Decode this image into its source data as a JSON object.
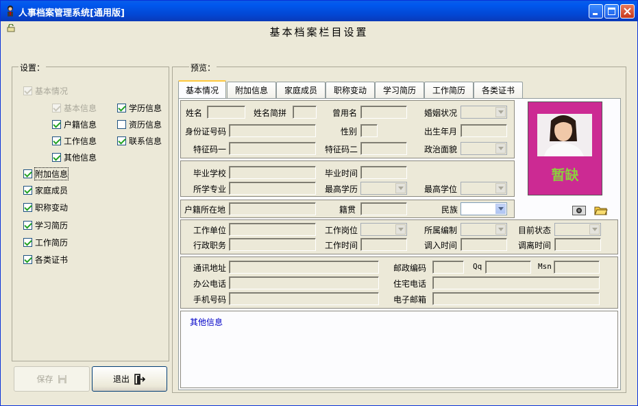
{
  "window": {
    "title": "人事档案管理系统[通用版]"
  },
  "page_title": "基本档案栏目设置",
  "settings": {
    "group_label": "设置：",
    "basic": {
      "label": "基本情况",
      "checked": true,
      "disabled": true
    },
    "basic_info": {
      "label": "基本信息",
      "checked": true,
      "disabled": true
    },
    "household": {
      "label": "户籍信息",
      "checked": true
    },
    "work_info": {
      "label": "工作信息",
      "checked": true
    },
    "other_info": {
      "label": "其他信息",
      "checked": true
    },
    "education_info": {
      "label": "学历信息",
      "checked": true
    },
    "qualification_info": {
      "label": "资历信息",
      "checked": false
    },
    "contact_info": {
      "label": "联系信息",
      "checked": true
    },
    "extra": {
      "label": "附加信息",
      "checked": true
    },
    "family": {
      "label": "家庭成员",
      "checked": true
    },
    "title_change": {
      "label": "职称变动",
      "checked": true
    },
    "study": {
      "label": "学习简历",
      "checked": true
    },
    "work_history": {
      "label": "工作简历",
      "checked": true
    },
    "certs": {
      "label": "各类证书",
      "checked": true
    }
  },
  "buttons": {
    "save": "保存",
    "exit": "退出"
  },
  "preview": {
    "group_label": "预览：",
    "tabs": [
      "基本情况",
      "附加信息",
      "家庭成员",
      "职称变动",
      "学习简历",
      "工作简历",
      "各类证书"
    ],
    "photo_text": "暂缺",
    "labels": {
      "name": "姓名",
      "pinyin": "姓名简拼",
      "former_name": "曾用名",
      "marital": "婚姻状况",
      "id_no": "身份证号码",
      "gender": "性别",
      "birth": "出生年月",
      "feature1": "特征码一",
      "feature2": "特征码二",
      "political": "政治面貌",
      "school": "毕业学校",
      "grad_time": "毕业时间",
      "major": "所学专业",
      "top_edu": "最高学历",
      "top_degree": "最高学位",
      "hukou": "户籍所在地",
      "native": "籍贯",
      "ethnic": "民族",
      "employer": "工作单位",
      "position": "工作岗位",
      "staffing": "所属编制",
      "status": "目前状态",
      "admin_duty": "行政职务",
      "work_time": "工作时间",
      "transfer_in": "调入时间",
      "transfer_out": "调离时间",
      "address": "通讯地址",
      "postcode": "邮政编码",
      "qq": "Qq",
      "msn": "Msn",
      "office_tel": "办公电话",
      "home_tel": "住宅电话",
      "mobile": "手机号码",
      "email": "电子邮箱",
      "other": "其他信息"
    }
  },
  "colors": {
    "title_blue": "#0058ee",
    "photo_bg": "#cc2a93",
    "photo_text": "#8ccf3e",
    "other_info": "#0000c8"
  }
}
